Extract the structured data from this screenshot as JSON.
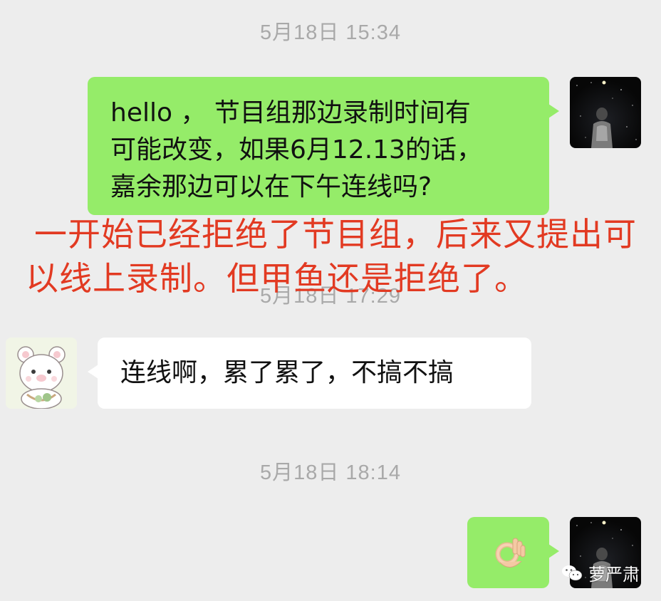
{
  "chat": {
    "timestamps": [
      "5月18日 15:34",
      "5月18日 17:29",
      "5月18日 18:14"
    ],
    "messages": [
      {
        "sender": "me",
        "lines": [
          "hello ， 节目组那边录制时间有",
          "可能改变，如果6月12.13的话，",
          "嘉余那边可以在下午连线吗?"
        ]
      },
      {
        "sender": "other",
        "text": "连线啊，累了累了，不搞不搞"
      },
      {
        "sender": "me",
        "emoji": "👌🏻"
      }
    ]
  },
  "annotation": {
    "text": "一开始已经拒绝了节目组，后来又提出可以线上录制。但甲鱼还是拒绝了。",
    "color": "#e23a22"
  },
  "watermark": {
    "text": "萝严肃"
  },
  "colors": {
    "background": "#ededed",
    "bubble_mine": "#95ec69",
    "bubble_other": "#ffffff",
    "timestamp": "#a9a9a9"
  }
}
